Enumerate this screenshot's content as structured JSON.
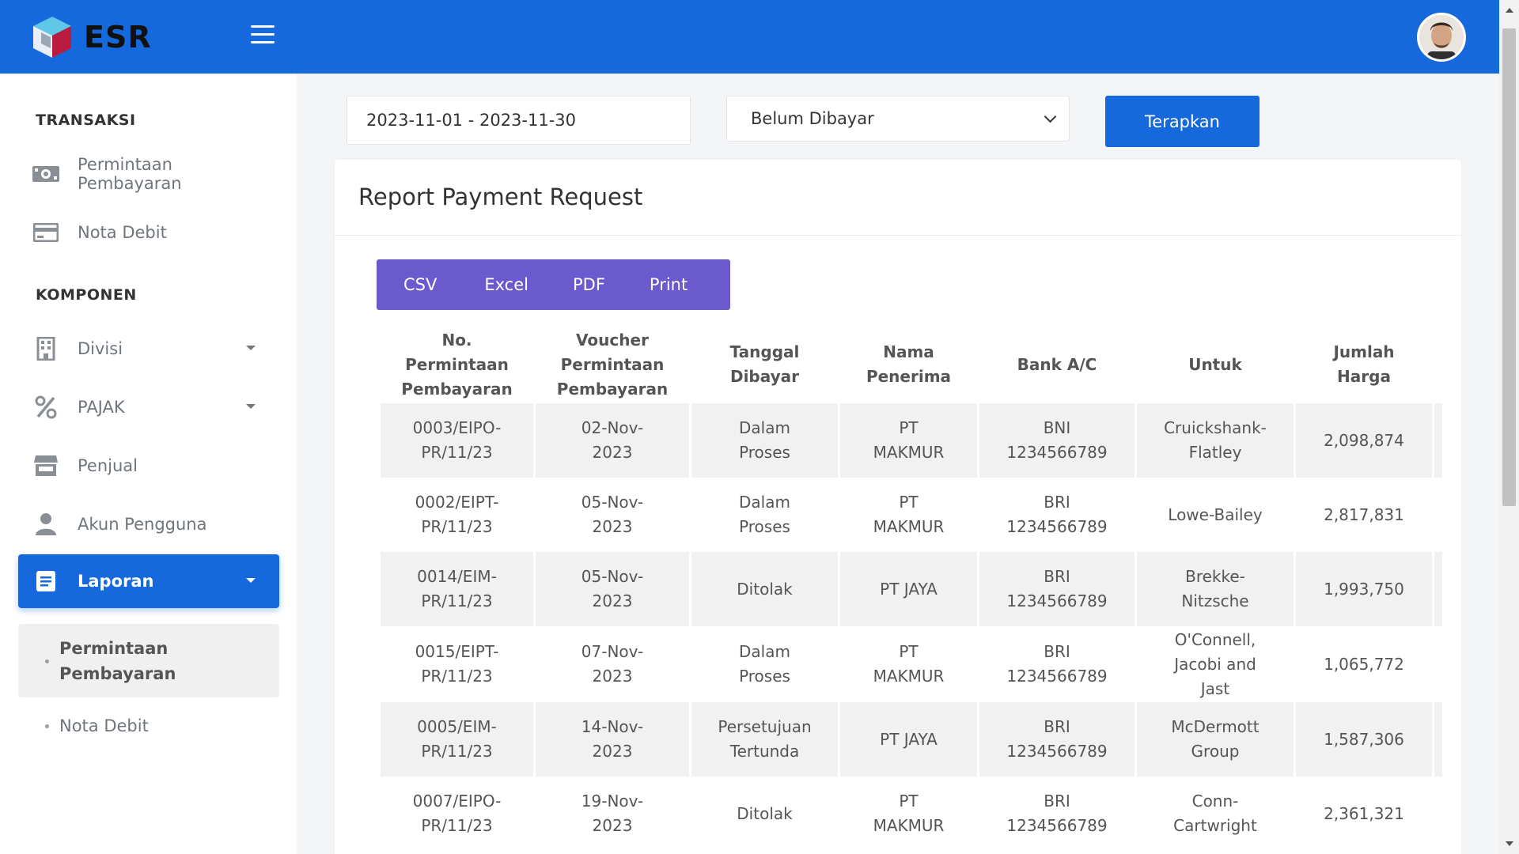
{
  "brand": {
    "name": "ESR"
  },
  "sidebar": {
    "section_transaksi": "TRANSAKSI",
    "section_komponen": "KOMPONEN",
    "items": [
      {
        "label": "Permintaan Pembayaran",
        "icon": "money-icon"
      },
      {
        "label": "Nota Debit",
        "icon": "credit-card-icon"
      },
      {
        "label": "Divisi",
        "icon": "building-icon"
      },
      {
        "label": "PAJAK",
        "icon": "percent-icon"
      },
      {
        "label": "Penjual",
        "icon": "store-icon"
      },
      {
        "label": "Akun Pengguna",
        "icon": "user-icon"
      },
      {
        "label": "Laporan",
        "icon": "report-icon"
      }
    ],
    "sub_items": [
      {
        "label_line1": "Permintaan",
        "label_line2": "Pembayaran"
      },
      {
        "label": "Nota Debit"
      }
    ]
  },
  "filters": {
    "date_range": "2023-11-01 - 2023-11-30",
    "status_selected": "Belum Dibayar",
    "apply_label": "Terapkan"
  },
  "report": {
    "title": "Report Payment Request",
    "export_buttons": [
      "CSV",
      "Excel",
      "PDF",
      "Print"
    ],
    "columns": [
      [
        "No.",
        "Permintaan",
        "Pembayaran"
      ],
      [
        "Voucher",
        "Permintaan",
        "Pembayaran"
      ],
      [
        "Tanggal",
        "Dibayar"
      ],
      [
        "Nama",
        "Penerima"
      ],
      [
        "Bank A/C"
      ],
      [
        "Untuk"
      ],
      [
        "Jumlah",
        "Harga"
      ]
    ],
    "rows": [
      [
        [
          "0003/EIPO-",
          "PR/11/23"
        ],
        [
          "02-Nov-",
          "2023"
        ],
        [
          "Dalam",
          "Proses"
        ],
        [
          "PT",
          "MAKMUR"
        ],
        [
          "BNI",
          "1234566789"
        ],
        [
          "Cruickshank-",
          "Flatley"
        ],
        [
          "2,098,874"
        ]
      ],
      [
        [
          "0002/EIPT-",
          "PR/11/23"
        ],
        [
          "05-Nov-",
          "2023"
        ],
        [
          "Dalam",
          "Proses"
        ],
        [
          "PT",
          "MAKMUR"
        ],
        [
          "BRI",
          "1234566789"
        ],
        [
          "Lowe-Bailey"
        ],
        [
          "2,817,831"
        ]
      ],
      [
        [
          "0014/EIM-",
          "PR/11/23"
        ],
        [
          "05-Nov-",
          "2023"
        ],
        [
          "Ditolak"
        ],
        [
          "PT JAYA"
        ],
        [
          "BRI",
          "1234566789"
        ],
        [
          "Brekke-",
          "Nitzsche"
        ],
        [
          "1,993,750"
        ]
      ],
      [
        [
          "0015/EIPT-",
          "PR/11/23"
        ],
        [
          "07-Nov-",
          "2023"
        ],
        [
          "Dalam",
          "Proses"
        ],
        [
          "PT",
          "MAKMUR"
        ],
        [
          "BRI",
          "1234566789"
        ],
        [
          "O'Connell,",
          "Jacobi and",
          "Jast"
        ],
        [
          "1,065,772"
        ]
      ],
      [
        [
          "0005/EIM-",
          "PR/11/23"
        ],
        [
          "14-Nov-",
          "2023"
        ],
        [
          "Persetujuan",
          "Tertunda"
        ],
        [
          "PT JAYA"
        ],
        [
          "BRI",
          "1234566789"
        ],
        [
          "McDermott",
          "Group"
        ],
        [
          "1,587,306"
        ]
      ],
      [
        [
          "0007/EIPO-",
          "PR/11/23"
        ],
        [
          "19-Nov-",
          "2023"
        ],
        [
          "Ditolak"
        ],
        [
          "PT",
          "MAKMUR"
        ],
        [
          "BRI",
          "1234566789"
        ],
        [
          "Conn-",
          "Cartwright"
        ],
        [
          "2,361,321"
        ]
      ]
    ]
  },
  "colors": {
    "primary": "#1569dd",
    "export_group": "#6a5acd",
    "stripe": "#f1f1f1"
  }
}
